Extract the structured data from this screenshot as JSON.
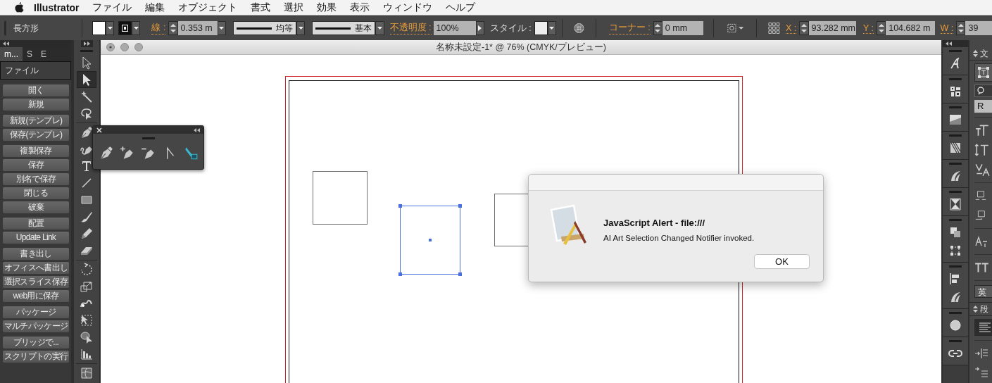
{
  "menubar": {
    "app_name": "Illustrator",
    "menus": [
      "ファイル",
      "編集",
      "オブジェクト",
      "書式",
      "選択",
      "効果",
      "表示",
      "ウィンドウ",
      "ヘルプ"
    ]
  },
  "control_bar": {
    "object_type": "長方形",
    "stroke_label": "線 :",
    "stroke_weight": "0.353 m",
    "stroke_profile": "均等",
    "brush": "基本",
    "opacity_label": "不透明度 :",
    "opacity": "100%",
    "style_label": "スタイル :",
    "corner_label": "コーナー :",
    "corner": "0 mm",
    "x_label": "X :",
    "x": "93.282 mm",
    "y_label": "Y :",
    "y": "104.682 m",
    "w_label": "W :",
    "w": "39"
  },
  "script_panel": {
    "tabs": [
      {
        "label": "m...",
        "selected": true
      },
      {
        "label": "S",
        "selected": false
      },
      {
        "label": "E",
        "selected": false
      }
    ],
    "section": "ファイル",
    "groups": [
      {
        "buttons": [
          "開く",
          "新規"
        ]
      },
      {
        "buttons": [
          "新規(テンプレ)",
          "保存(テンプレ)"
        ]
      },
      {
        "buttons": [
          "複製保存",
          "保存",
          "別名で保存",
          "閉じる",
          "破棄"
        ]
      },
      {
        "buttons": [
          "配置",
          "Update Link"
        ]
      },
      {
        "buttons": [
          "書き出し",
          "オフィスへ書出し",
          "選択スライス保存",
          "web用に保存"
        ]
      },
      {
        "buttons": [
          "パッケージ",
          "マルチパッケージ"
        ]
      },
      {
        "buttons": [
          "ブリッジで...",
          "スクリプトの実行"
        ]
      }
    ]
  },
  "tool_groups": [
    {
      "tools": [
        {
          "kind": "select",
          "selected": false
        },
        {
          "kind": "direct-select",
          "selected": true
        },
        {
          "kind": "magic-wand",
          "selected": false
        },
        {
          "kind": "lasso",
          "selected": false
        }
      ]
    },
    {
      "tools": [
        {
          "kind": "pen",
          "selected": false
        },
        {
          "kind": "curvature",
          "selected": false
        },
        {
          "kind": "type",
          "selected": false
        },
        {
          "kind": "line",
          "selected": false
        },
        {
          "kind": "rectangle",
          "selected": false
        },
        {
          "kind": "brush",
          "selected": false
        },
        {
          "kind": "pencil",
          "selected": false
        },
        {
          "kind": "eraser",
          "selected": false
        }
      ]
    },
    {
      "tools": [
        {
          "kind": "rotate",
          "selected": false
        },
        {
          "kind": "scale",
          "selected": false
        },
        {
          "kind": "puppet",
          "selected": false
        },
        {
          "kind": "free-transform",
          "selected": false
        },
        {
          "kind": "shape-builder",
          "selected": false
        },
        {
          "kind": "graph",
          "selected": false
        }
      ]
    },
    {
      "tools": [
        {
          "kind": "mesh",
          "selected": false
        }
      ]
    }
  ],
  "pen_flyout": {
    "tools": [
      {
        "kind": "pen"
      },
      {
        "kind": "add-anchor"
      },
      {
        "kind": "delete-anchor"
      },
      {
        "kind": "anchor-point"
      },
      {
        "kind": "marker"
      }
    ]
  },
  "document": {
    "title": "名称未設定-1* @ 76% (CMYK/プレビュー)",
    "shapes": [
      {
        "selected": false
      },
      {
        "selected": true
      },
      {
        "selected": false
      }
    ]
  },
  "right_dock": {
    "groups": [
      {
        "icons": [
          {
            "kind": "glyph"
          }
        ]
      },
      {
        "icons": [
          {
            "kind": "pattern"
          }
        ]
      },
      {
        "icons": [
          {
            "kind": "swatch"
          }
        ]
      },
      {
        "icons": [
          {
            "kind": "barcode"
          }
        ]
      },
      {
        "icons": [
          {
            "kind": "swoosh"
          }
        ]
      },
      {
        "icons": [
          {
            "kind": "hourglass"
          }
        ]
      },
      {
        "icons": [
          {
            "kind": "pathfinder"
          },
          {
            "kind": "transform"
          }
        ]
      },
      {
        "icons": [
          {
            "kind": "align"
          },
          {
            "kind": "swoosh"
          }
        ]
      },
      {
        "icons": [
          {
            "kind": "circle"
          }
        ]
      },
      {
        "icons": [
          {
            "kind": "link"
          }
        ]
      }
    ]
  },
  "character_panel": {
    "title": "文",
    "font_style": "R",
    "language": "英"
  },
  "paragraph_panel": {
    "title": "段"
  },
  "dialog": {
    "title": "JavaScript Alert - file:///",
    "message": "AI Art Selection Changed Notifier invoked.",
    "button": "OK"
  }
}
